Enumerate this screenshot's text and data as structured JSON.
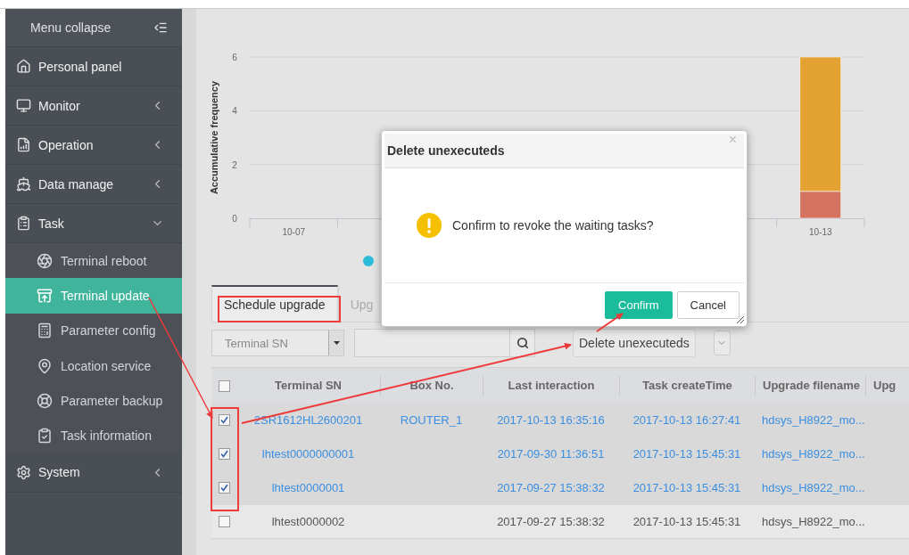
{
  "sidebar": {
    "collapse_label": "Menu collapse",
    "items": [
      {
        "kind": "link",
        "label": "Personal panel",
        "selected": false
      },
      {
        "kind": "group",
        "label": "Monitor",
        "expanded": false,
        "selected": false
      },
      {
        "kind": "group",
        "label": "Operation",
        "expanded": false,
        "selected": false
      },
      {
        "kind": "group",
        "label": "Data manage",
        "expanded": false,
        "selected": false
      },
      {
        "kind": "group",
        "label": "Task",
        "expanded": true,
        "selected": false,
        "children": [
          {
            "label": "Terminal reboot",
            "selected": false
          },
          {
            "label": "Terminal update",
            "selected": true
          },
          {
            "label": "Parameter config",
            "selected": false
          },
          {
            "label": "Location service",
            "selected": false
          },
          {
            "label": "Parameter backup",
            "selected": false
          },
          {
            "label": "Task information",
            "selected": false
          }
        ]
      },
      {
        "kind": "group",
        "label": "System",
        "expanded": false,
        "selected": false
      }
    ]
  },
  "chart": {
    "chart_data": {
      "type": "bar",
      "ylabel": "Accumulative frequency",
      "categories": [
        "10-07",
        null,
        null,
        null,
        null,
        null,
        "10-13"
      ],
      "stacked": true,
      "ylim": [
        0,
        6
      ],
      "yticks": [
        0,
        2,
        4,
        6
      ],
      "series": [
        {
          "color": "#d4735f",
          "values": [
            0,
            0,
            null,
            null,
            null,
            null,
            1
          ]
        },
        {
          "color": "#e4a233",
          "values": [
            0,
            0,
            null,
            null,
            null,
            null,
            5
          ]
        }
      ]
    },
    "legend": [
      {
        "color": "#2bbcd9"
      }
    ]
  },
  "tabs": [
    {
      "label": "Schedule upgrade",
      "selected": true
    },
    {
      "label": "Upg",
      "selected": false
    }
  ],
  "filter": {
    "field_select": "Terminal SN",
    "action": "Delete unexecuteds"
  },
  "table": {
    "all_checked": false,
    "columns": [
      "Terminal SN",
      "Box No.",
      "Last interaction",
      "Task createTime",
      "Upgrade filename",
      "Upg"
    ],
    "rows": [
      {
        "checked": true,
        "cells": [
          "2SR1612HL2600201",
          "ROUTER_1",
          "2017-10-13 16:35:16",
          "2017-10-13 16:27:41",
          "hdsys_H8922_mo..."
        ]
      },
      {
        "checked": true,
        "cells": [
          "lhtest0000000001",
          "",
          "2017-09-30 11:36:51",
          "2017-10-13 15:45:31",
          "hdsys_H8922_mo..."
        ]
      },
      {
        "checked": true,
        "cells": [
          "lhtest0000001",
          "",
          "2017-09-27 15:38:32",
          "2017-10-13 15:45:31",
          "hdsys_H8922_mo..."
        ]
      },
      {
        "checked": false,
        "cells": [
          "lhtest0000002",
          "",
          "2017-09-27 15:38:32",
          "2017-10-13 15:45:31",
          "hdsys_H8922_mo..."
        ]
      }
    ]
  },
  "dialog": {
    "title": "Delete unexecuteds",
    "close": "×",
    "message": "Confirm to revoke the waiting tasks?",
    "buttons": [
      {
        "kind": "primary",
        "label": "Confirm"
      },
      {
        "kind": "default",
        "label": "Cancel"
      }
    ]
  }
}
